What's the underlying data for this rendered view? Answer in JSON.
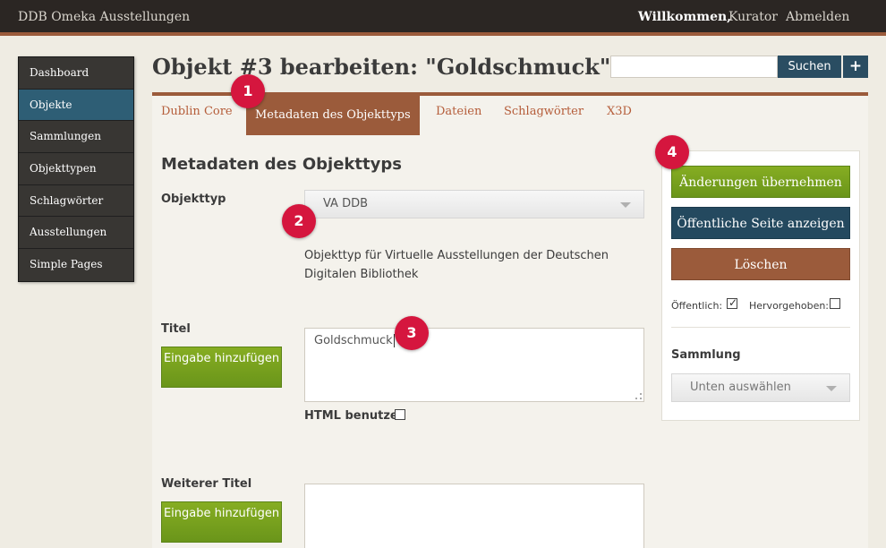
{
  "header": {
    "site_title": "DDB Omeka Ausstellungen",
    "welcome": "Willkommen,",
    "user": "Kurator",
    "logout": "Abmelden"
  },
  "sidebar": {
    "items": [
      {
        "label": "Dashboard",
        "active": false
      },
      {
        "label": "Objekte",
        "active": true
      },
      {
        "label": "Sammlungen",
        "active": false
      },
      {
        "label": "Objekttypen",
        "active": false
      },
      {
        "label": "Schlagwörter",
        "active": false
      },
      {
        "label": "Ausstellungen",
        "active": false
      },
      {
        "label": "Simple Pages",
        "active": false
      }
    ]
  },
  "page": {
    "title": "Objekt #3 bearbeiten: \"Goldschmuck\""
  },
  "search": {
    "value": "",
    "button_label": "Suchen",
    "plus_label": "+"
  },
  "tabs": [
    {
      "label": "Dublin Core",
      "active": false
    },
    {
      "label": "Metadaten des Objekttyps",
      "active": true
    },
    {
      "label": "Dateien",
      "active": false
    },
    {
      "label": "Schlagwörter",
      "active": false
    },
    {
      "label": "X3D",
      "active": false
    }
  ],
  "form": {
    "section_title": "Metadaten des Objekttyps",
    "item_type": {
      "label": "Objekttyp",
      "selected": "VA DDB",
      "description": "Objekttyp für Virtuelle Ausstellungen der Deutschen Digitalen Bibliothek"
    },
    "title_field": {
      "label": "Titel",
      "add_input_label": "Eingabe hinzufügen",
      "value": "Goldschmuck",
      "use_html_label": "HTML benutzen",
      "use_html": false
    },
    "alt_title_field": {
      "label": "Weiterer Titel",
      "add_input_label": "Eingabe hinzufügen",
      "value": ""
    }
  },
  "side_panel": {
    "save_label": "Änderungen übernehmen",
    "view_public_label": "Öffentliche Seite anzeigen",
    "delete_label": "Löschen",
    "public_label": "Öffentlich:",
    "public_checked": true,
    "featured_label": "Hervorgehoben:",
    "featured_checked": false,
    "collection_title": "Sammlung",
    "collection_select": "Unten auswählen"
  },
  "badges": [
    "1",
    "2",
    "3",
    "4"
  ],
  "colors": {
    "accent": "#9b5b3b",
    "nav_active": "#2e5e75",
    "button_green": "#7aa21e",
    "button_blue": "#24495f",
    "badge": "#d5163e"
  }
}
